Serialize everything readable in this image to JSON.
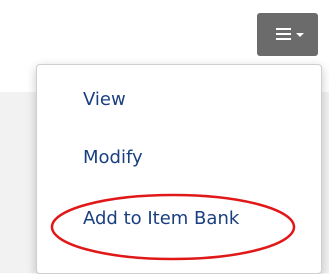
{
  "actions_menu": {
    "toggle_icon": "hamburger-menu-icon",
    "caret_icon": "caret-down-icon",
    "toggle_color": "#6b6b6b",
    "items": [
      {
        "label": "View"
      },
      {
        "label": "Modify"
      },
      {
        "label": "Add to Item Bank"
      }
    ],
    "item_text_color": "#1a3f80",
    "highlighted_item": "Add to Item Bank",
    "highlight_color": "#e01818"
  }
}
